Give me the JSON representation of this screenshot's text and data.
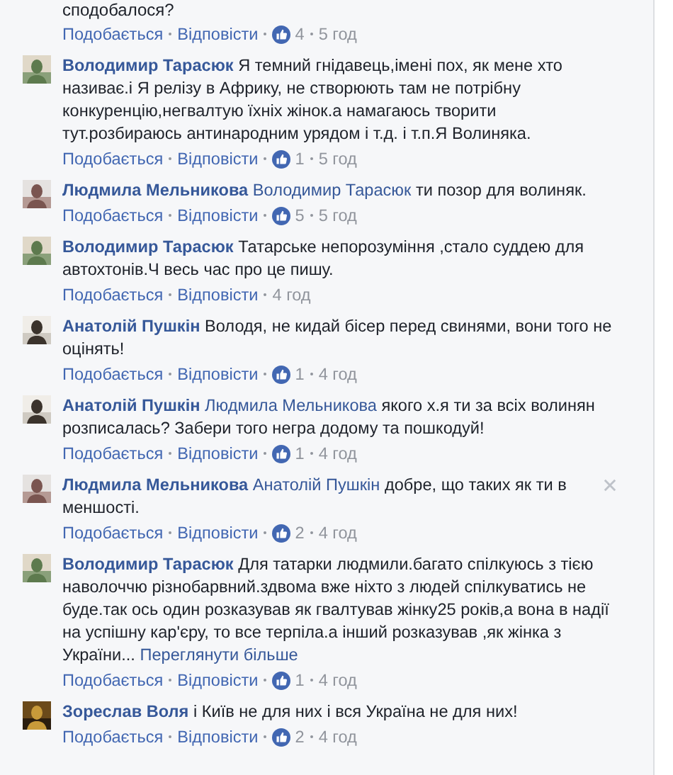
{
  "previous_comment": {
    "text_tail": "сподобалося?",
    "like": "Подобається",
    "reply": "Відповісти",
    "likes": "4",
    "time": "5 год"
  },
  "comments": [
    {
      "author": "Володимир Тарасюк",
      "text": "Я темний гнідавець,імені пох, як мене хто називає.і Я релізу в Африку, не створюють там не потрібну конкуренцію,негвалтую їхніх жінок.а намагаюсь творити тут.розбираюсь антинародним урядом і т.д. і т.п.Я Волиняка.",
      "like": "Подобається",
      "reply": "Відповісти",
      "likes": "1",
      "time": "5 год",
      "closable": false
    },
    {
      "author": "Людмила Мельникова",
      "mention": "Володимир Тарасюк",
      "text": "ти позор для волиняк.",
      "like": "Подобається",
      "reply": "Відповісти",
      "likes": "5",
      "time": "5 год",
      "closable": false
    },
    {
      "author": "Володимир Тарасюк",
      "text": "Татарське непорозуміння ,стало суддею для автохтонів.Ч весь час про це пишу.",
      "like": "Подобається",
      "reply": "Відповісти",
      "time": "4 год",
      "closable": false
    },
    {
      "author": "Анатолій Пушкін",
      "text": "Володя, не кидай бісер перед свинями, вони того не оцінять!",
      "like": "Подобається",
      "reply": "Відповісти",
      "likes": "1",
      "time": "4 год",
      "closable": false
    },
    {
      "author": "Анатолій Пушкін",
      "mention": "Людмила Мельникова",
      "text": "якого х.я ти за всіх волинян розписалась? Забери того негра додому та пошкодуй!",
      "like": "Подобається",
      "reply": "Відповісти",
      "likes": "1",
      "time": "4 год",
      "closable": false
    },
    {
      "author": "Людмила Мельникова",
      "mention": "Анатолій Пушкін",
      "text": "добре, що таких як ти в меншості.",
      "like": "Подобається",
      "reply": "Відповісти",
      "likes": "2",
      "time": "4 год",
      "closable": true
    },
    {
      "author": "Володимир Тарасюк",
      "text": "Для татарки людмили.багато спілкуюсь з тією наволоччю різнобарвний.здвома вже ніхто з людей спілкуватись не буде.так ось один розказував як гвалтував жінку25 років,а вона в надії на успішну кар'єру, то все терпіла.а інший розказував ,як жінка з України...",
      "more": "Переглянути більше",
      "like": "Подобається",
      "reply": "Відповісти",
      "likes": "1",
      "time": "4 год",
      "closable": false
    },
    {
      "author": "Зореслав Воля",
      "text": "і Київ не для них і вся Україна не для них!",
      "like": "Подобається",
      "reply": "Відповісти",
      "likes": "2",
      "time": "4 год",
      "closable": false
    }
  ]
}
